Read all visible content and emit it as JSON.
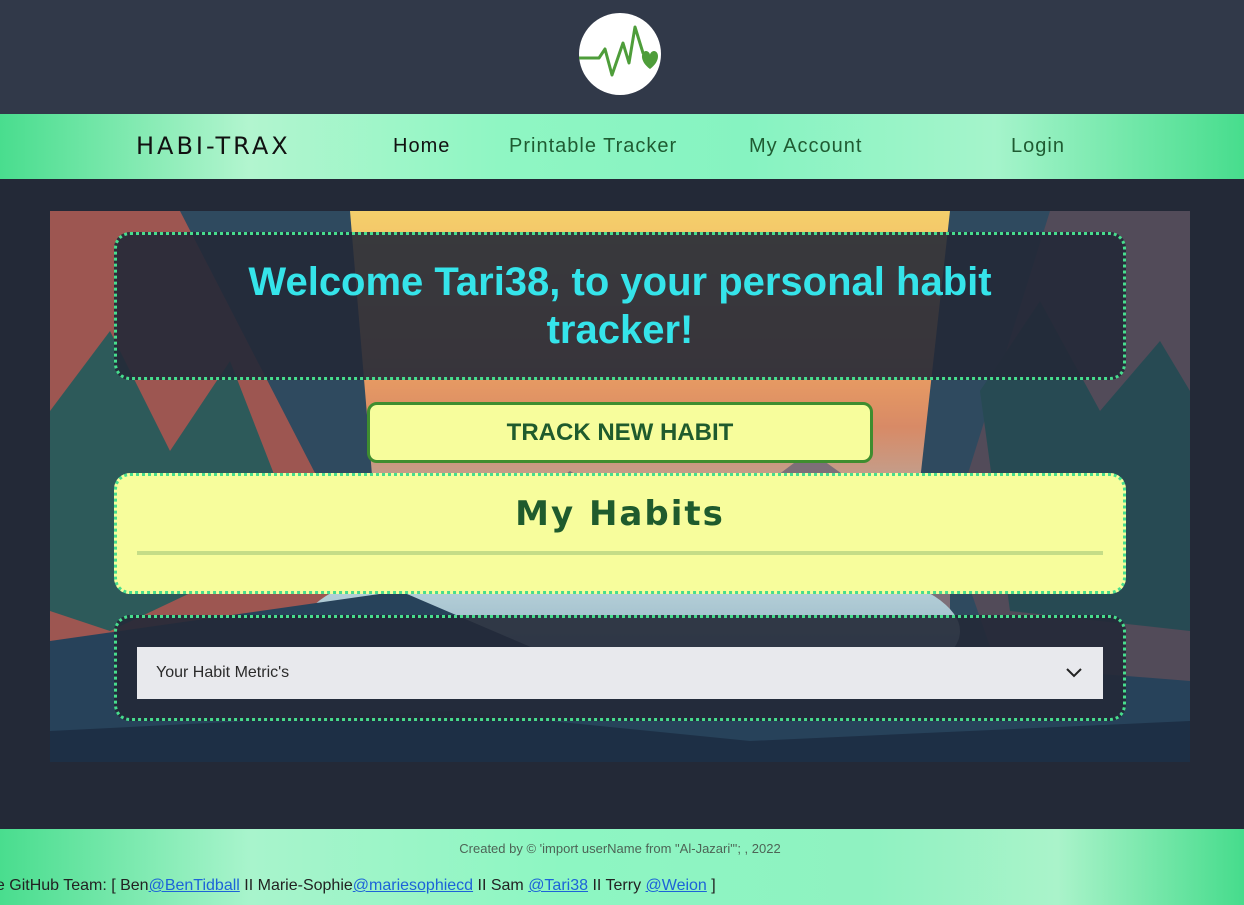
{
  "header": {
    "logo_icon": "heartbeat-heart-icon"
  },
  "nav": {
    "brand": "HABI-TRAX",
    "links": [
      {
        "label": "Home"
      },
      {
        "label": "Printable Tracker"
      },
      {
        "label": "My Account"
      },
      {
        "label": "Login"
      }
    ]
  },
  "main": {
    "welcome": "Welcome Tari38, to your personal habit tracker!",
    "track_button": "TRACK NEW HABIT",
    "habits_title": "My Habits",
    "metrics_select": "Your Habit Metric's"
  },
  "footer": {
    "credit": "Created by © 'import userName from \"Al-Jazari\"'; , 2022",
    "team_prefix": "he GitHub Team: [ Ben",
    "members": [
      {
        "handle": "@BenTidball",
        "separator": " II Marie-Sophie"
      },
      {
        "handle": "@mariesophiecd",
        "separator": " II Sam "
      },
      {
        "handle": "@Tari38",
        "separator": " II Terry "
      },
      {
        "handle": "@Weion",
        "separator": " ]"
      }
    ]
  },
  "colors": {
    "page_bg": "#232937",
    "header_bg": "#313949",
    "nav_green": "#47dd8d",
    "welcome_text": "#35e4ea",
    "accent_yellow": "#f7fd9c",
    "dark_green": "#1f5b2d"
  }
}
